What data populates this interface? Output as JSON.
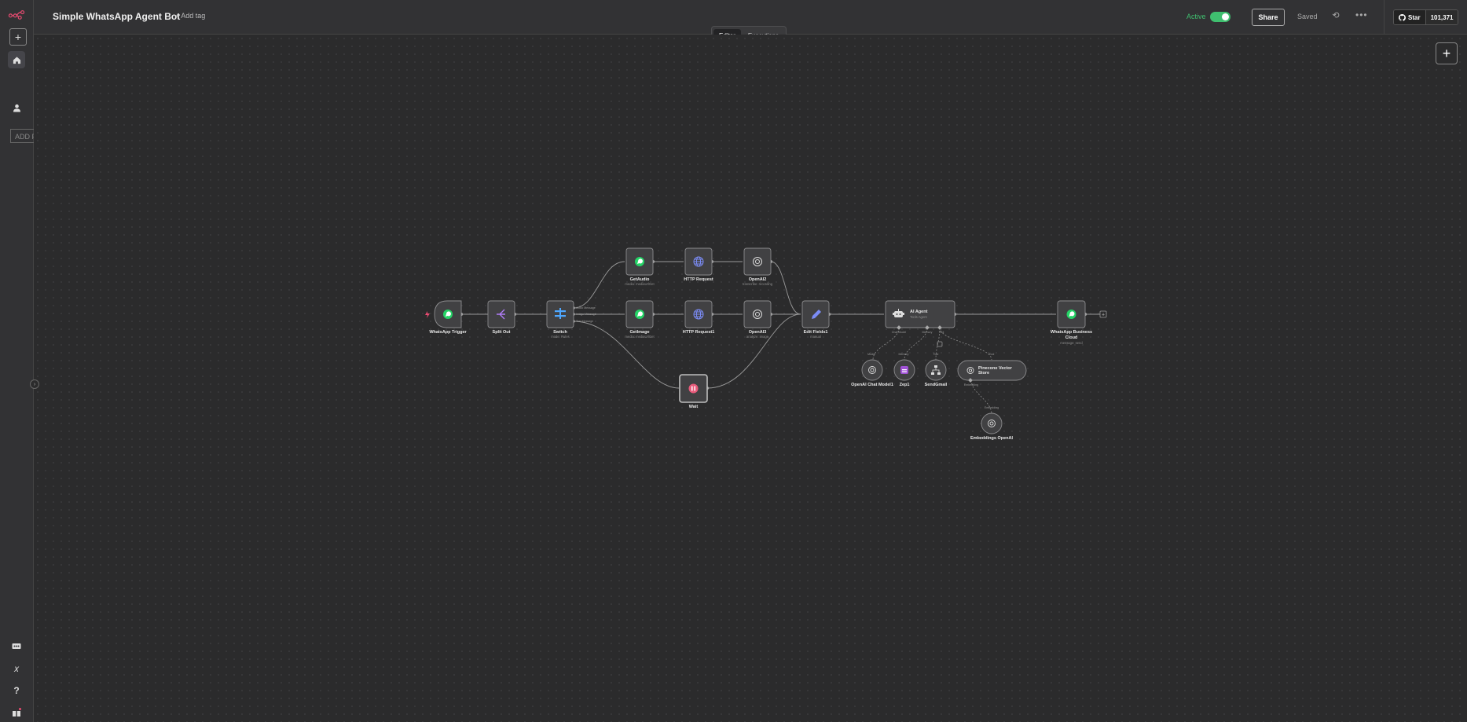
{
  "workflow": {
    "title": "Simple WhatsApp Agent Bot",
    "add_tag": "+ Add tag"
  },
  "header": {
    "active_label": "Active",
    "active": true,
    "share_label": "Share",
    "saved_label": "Saved",
    "github_star": "Star",
    "github_count": "101,371"
  },
  "tabs": [
    {
      "label": "Editor",
      "selected": true
    },
    {
      "label": "Executions",
      "selected": false
    }
  ],
  "sidebar": {
    "add_field_text": "ADD F"
  },
  "colors": {
    "accent": "#ea4b71",
    "active_green": "#3fbf6f",
    "whatsapp": "#25d366",
    "http": "#7b8cf6",
    "edit": "#7b8cf6",
    "switch": "#4ea7ff",
    "zep": "#a052d6"
  },
  "nodes": [
    {
      "id": "whatsapp-trigger",
      "title": "WhatsApp Trigger",
      "subtitle": "",
      "icon": "whatsapp-icon"
    },
    {
      "id": "split-out",
      "title": "Split Out",
      "subtitle": "",
      "icon": "split-icon"
    },
    {
      "id": "switch",
      "title": "Switch",
      "subtitle": "mode: Rules",
      "icon": "switch-icon"
    },
    {
      "id": "getaudio",
      "title": "GetAudio",
      "subtitle": "media: mediaUrlGet",
      "icon": "whatsapp-icon"
    },
    {
      "id": "http-request",
      "title": "HTTP Request",
      "subtitle": "",
      "icon": "globe-icon"
    },
    {
      "id": "openai2",
      "title": "OpenAI2",
      "subtitle": "transcribe: recording",
      "icon": "openai-icon"
    },
    {
      "id": "getimage",
      "title": "GetImage",
      "subtitle": "media: mediaUrlGet",
      "icon": "whatsapp-icon"
    },
    {
      "id": "http-request1",
      "title": "HTTP Request1",
      "subtitle": "",
      "icon": "globe-icon"
    },
    {
      "id": "openai3",
      "title": "OpenAI3",
      "subtitle": "analyze: image",
      "icon": "openai-icon"
    },
    {
      "id": "wait",
      "title": "Wait",
      "subtitle": "",
      "icon": "pause-icon"
    },
    {
      "id": "edit-fields1",
      "title": "Edit Fields1",
      "subtitle": "manual",
      "icon": "pencil-icon"
    },
    {
      "id": "ai-agent",
      "title": "AI Agent",
      "subtitle": "Tools Agent",
      "icon": "robot-icon"
    },
    {
      "id": "whatsapp-business-cloud",
      "title": "WhatsApp Business",
      "title2": "Cloud",
      "subtitle": "message: send",
      "icon": "whatsapp-icon"
    },
    {
      "id": "openai-chat-model1",
      "title": "OpenAI Chat Model1",
      "subtitle": "",
      "icon": "openai-icon"
    },
    {
      "id": "zep1",
      "title": "Zep1",
      "subtitle": "",
      "icon": "zep-icon"
    },
    {
      "id": "sendgmail",
      "title": "SendGmail",
      "subtitle": "",
      "icon": "tool-icon"
    },
    {
      "id": "pinecone-vector-store",
      "title": "Pinecone Vector",
      "title2": "Store",
      "subtitle": "",
      "icon": "pinecone-icon"
    },
    {
      "id": "embeddings-openai",
      "title": "Embeddings OpenAI",
      "subtitle": "",
      "icon": "openai-icon"
    }
  ],
  "switch_outputs": [
    "Audio Message",
    "Image Message",
    "Text Message"
  ],
  "agent_ports": [
    "Chat Model",
    "Memory",
    "Tool"
  ],
  "sub_ports": {
    "model": "Model",
    "memory": "Memory",
    "tool": "Tool",
    "embedding": "Embedding"
  }
}
